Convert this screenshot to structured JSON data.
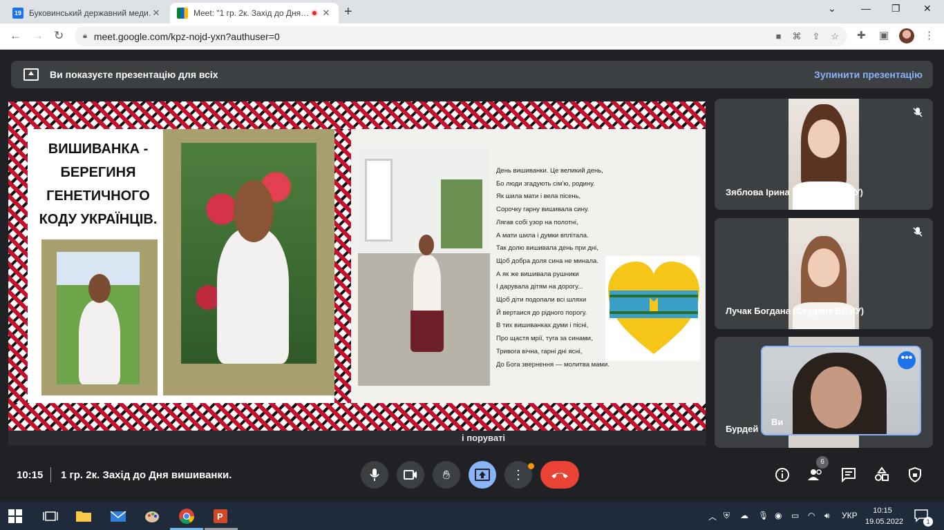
{
  "browser": {
    "tabs": [
      {
        "title": "Буковинський державний меди…",
        "active": false,
        "favicon": "calendar-19-icon"
      },
      {
        "title": "Meet: \"1 гр. 2к. Захід до Дня…",
        "active": true,
        "favicon": "meet-icon",
        "recording": true
      }
    ],
    "url": "meet.google.com/kpz-nojd-yxn?authuser=0"
  },
  "banner": {
    "text": "Ви показуєте презентацію для всіх",
    "stop_label": "Зупинити презентацію"
  },
  "slide": {
    "title_lines": [
      "ВИШИВАНКА -",
      "БЕРЕГИНЯ",
      "ГЕНЕТИЧНОГО",
      "КОДУ УКРАЇНЦІВ."
    ],
    "poem": [
      "День вишиванки. Це великий день,",
      "Бо люди згадують сім'ю, родину.",
      "Як шила мати і вела пісень,",
      "Сорочку гарну вишивала сину.",
      "Лягав собі узор на полотні,",
      "А мати шила і думки вплітала.",
      "Так долю вишивала день при дні,",
      "Щоб добра доля сина не минала.",
      "А як же вишивала рушники",
      "І дарувала дітям на дорогу...",
      "Щоб діти подолали всі шляхи",
      "Й вертаися до рідного порогу.",
      "В тих вишиванках думи і пісні,",
      "Про щастя мрії, туга за синами,",
      "Тривога вічна, гарні дні ясні,",
      "До Бога звернення — молитва мами."
    ],
    "partial_overlay_text": "і поруваті"
  },
  "participants": [
    {
      "name": "Зяблова Ірина (Студент БДМУ)",
      "muted": true
    },
    {
      "name": "Лучак Богдана (Студент БДМУ)",
      "muted": true
    },
    {
      "name": "Бурдей",
      "muted": false
    }
  ],
  "self_view": {
    "name": "Ви"
  },
  "bottom_bar": {
    "time": "10:15",
    "meeting_title": "1 гр. 2к. Захід до Дня вишиванки.",
    "participants_count": "6"
  },
  "taskbar": {
    "language": "УКР",
    "clock_time": "10:15",
    "clock_date": "19.05.2022",
    "notification_count": "1"
  },
  "colors": {
    "meet_bg": "#202124",
    "leave_red": "#ea4335",
    "present_blue": "#8ab4f8",
    "accent_blue": "#1a73e8"
  }
}
